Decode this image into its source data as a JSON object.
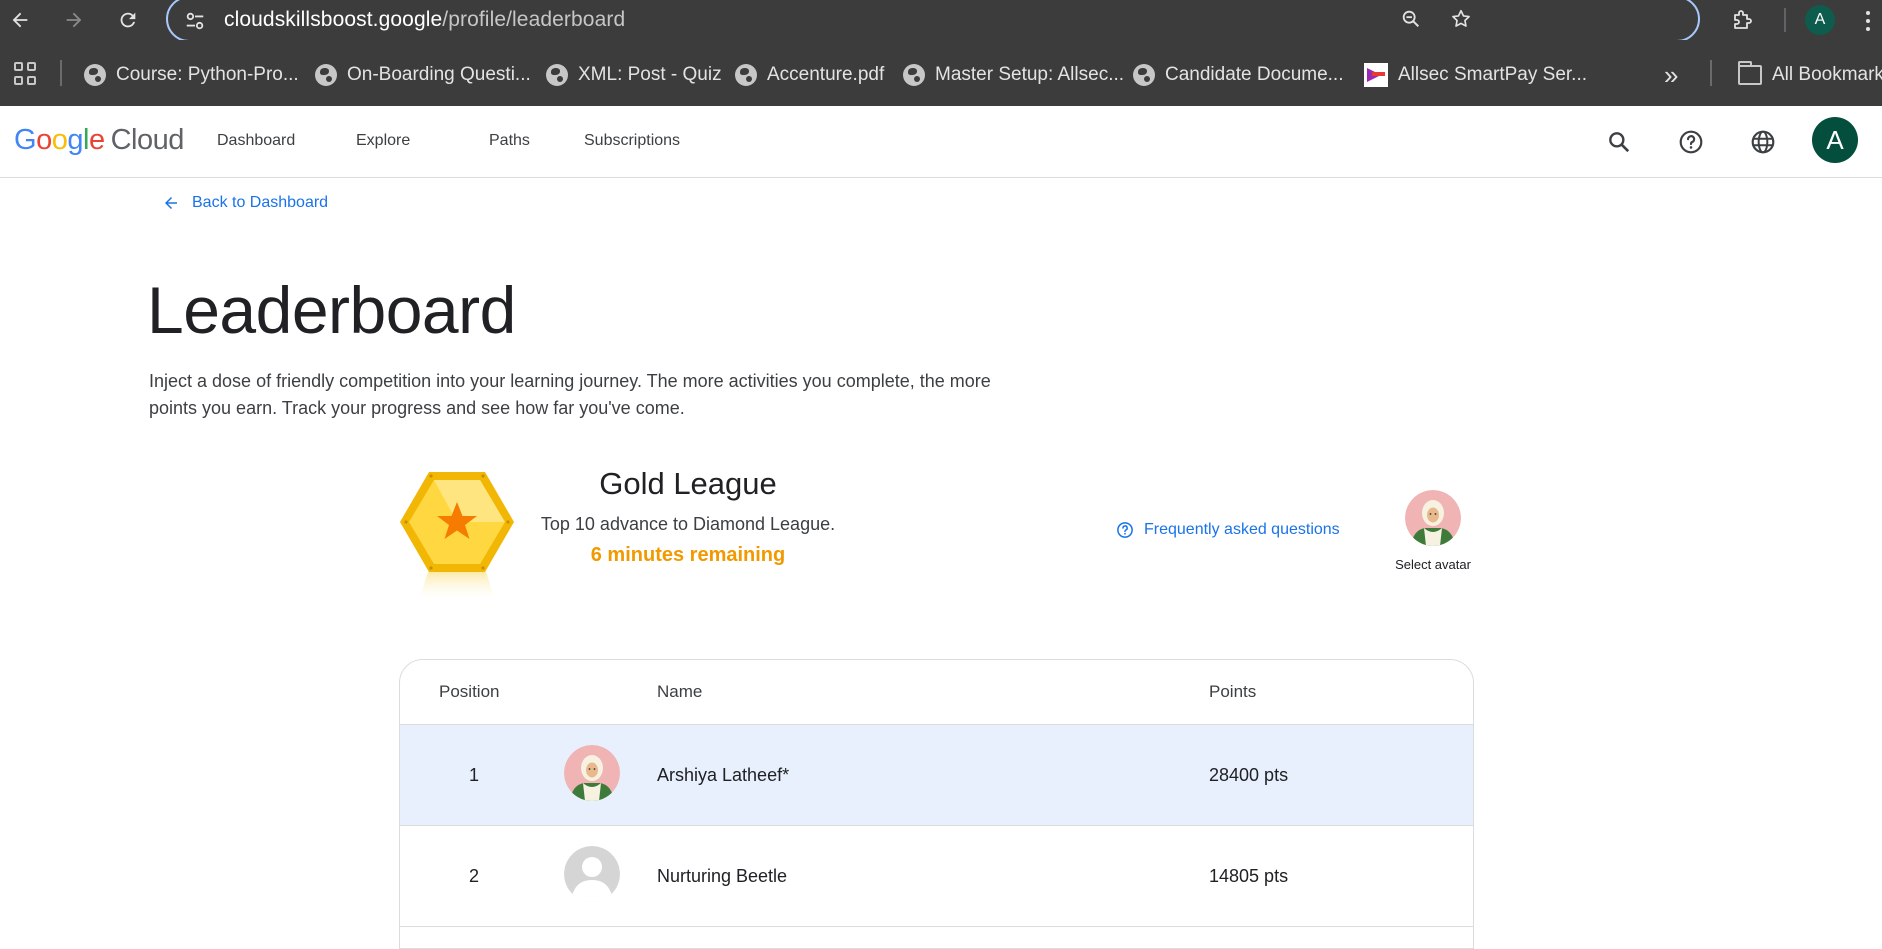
{
  "browser": {
    "url_host": "cloudskillsboost.google",
    "url_path": "/profile/leaderboard",
    "profile_initial": "A",
    "bookmarks": [
      {
        "label": "Course: Python-Pro..."
      },
      {
        "label": "On-Boarding Questi..."
      },
      {
        "label": "XML: Post - Quiz"
      },
      {
        "label": "Accenture.pdf"
      },
      {
        "label": "Master Setup: Allsec..."
      },
      {
        "label": "Candidate Docume..."
      },
      {
        "label": "Allsec SmartPay Ser..."
      }
    ],
    "overflow_label": "»",
    "all_bookmarks_label": "All Bookmarks"
  },
  "header": {
    "logo_google": "Google",
    "logo_cloud": "Cloud",
    "nav": [
      {
        "label": "Dashboard"
      },
      {
        "label": "Explore"
      },
      {
        "label": "Paths"
      },
      {
        "label": "Subscriptions"
      }
    ],
    "user_initial": "A"
  },
  "page": {
    "back_label": "Back to Dashboard",
    "title": "Leaderboard",
    "description": "Inject a dose of friendly competition into your learning journey. The more activities you complete, the more points you earn. Track your progress and see how far you've come."
  },
  "league": {
    "name": "Gold League",
    "subtitle": "Top 10 advance to Diamond League.",
    "time_remaining": "6 minutes remaining",
    "faq_label": "Frequently asked questions",
    "select_avatar_label": "Select avatar"
  },
  "table": {
    "columns": [
      "Position",
      "Name",
      "Points"
    ],
    "rows": [
      {
        "position": "1",
        "name": "Arshiya Latheef*",
        "points": "28400 pts"
      },
      {
        "position": "2",
        "name": "Nurturing Beetle",
        "points": "14805 pts"
      }
    ]
  },
  "colors": {
    "accent": "#1a73e8",
    "time_remaining": "#f29900",
    "highlight_row": "#e8f0fe",
    "gold": "#fbc02d"
  }
}
